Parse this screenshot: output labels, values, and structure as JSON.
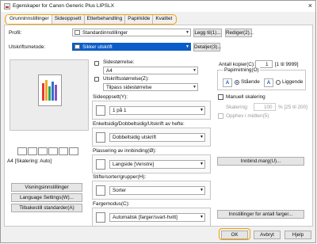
{
  "window": {
    "title": "Egenskaper for Canon Generic Plus LIPSLX"
  },
  "tabs": [
    "Grunninnstillinger",
    "Sideoppsett",
    "Etterbehandling",
    "Papirkilde",
    "Kvalitet"
  ],
  "profile": {
    "label": "Profil:",
    "value": "Standardinnstillinger",
    "add_btn": "Legg til(1)...",
    "edit_btn": "Rediger(2)..."
  },
  "output": {
    "label": "Utskriftsmetode:",
    "value": "Sikker utskrift",
    "details_btn": "Detaljer(3)..."
  },
  "preview": {
    "caption": "A4 [Skalering: Auto]"
  },
  "page_size": {
    "label": "Sidestørrelse:",
    "value": "A4"
  },
  "output_size": {
    "label": "Utskriftsstørrelse(Z):",
    "value": "Tilpass sidestørrelse"
  },
  "copies": {
    "label": "Antall kopier(C):",
    "value": "1",
    "range": "[1 til 9999]"
  },
  "orientation": {
    "label": "Papirretning(O)",
    "portrait": "Stående",
    "landscape": "Liggende"
  },
  "layout": {
    "label": "Sideoppsett(Y):",
    "value": "1 på 1"
  },
  "manual_scaling": {
    "label": "Manuell skalering",
    "scaling_label": "Skalering:",
    "value": "100",
    "range": "% [25 til 200]",
    "center_label": "Opphev i midten(5)"
  },
  "duplex": {
    "label": "Enkeltsidig/Dobbeltsidig/Utskrift av hefte:",
    "value": "Dobbeltsidig utskrift"
  },
  "binding": {
    "label": "Plassering av innbinding(Ø):",
    "value": "Langside [Venstre]",
    "margin_btn": "Innbind.marg(U)..."
  },
  "staple": {
    "label": "Stifte/sorter/grupper(H):",
    "value": "Sorter"
  },
  "color": {
    "label": "Fargemodus(C):",
    "value": "Automatisk [farger/svart-hvitt]",
    "settings_btn": "Innstillinger for antall farger..."
  },
  "left_buttons": [
    "Visningsinnstillinger",
    "Language Settings(W)...",
    "Tilbakestill standarder(A)"
  ],
  "footer": {
    "ok": "OK",
    "cancel": "Avbryt",
    "help": "Hjelp"
  },
  "colors": {
    "accent": "#f2a200",
    "highlight": "#0a5cc8"
  }
}
